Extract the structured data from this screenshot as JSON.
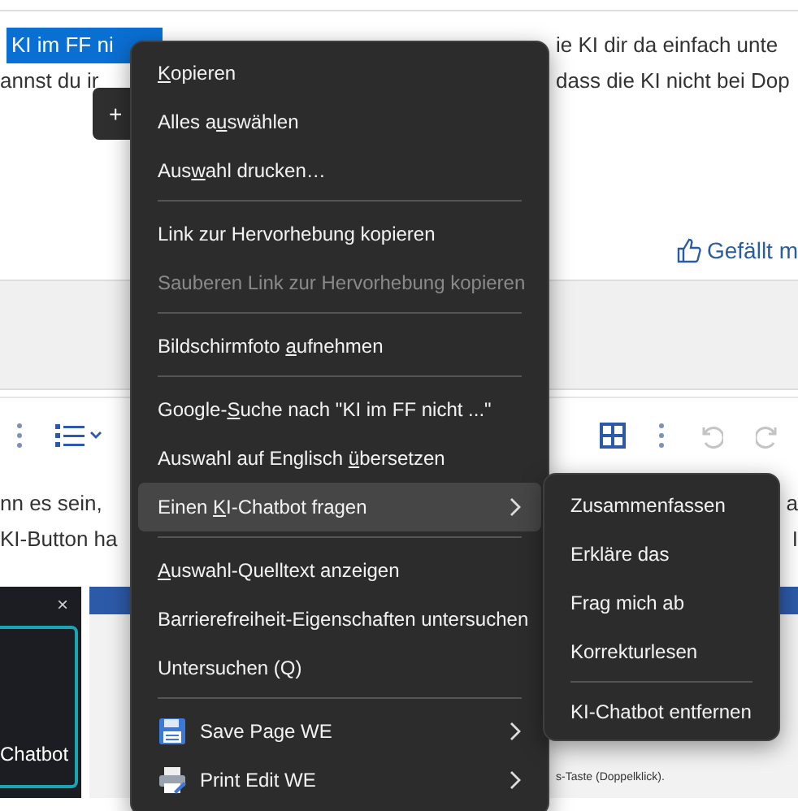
{
  "post": {
    "line_1": {
      "selection": "KI im FF ni",
      "right": "ie KI dir da einfach unte"
    },
    "line_2": {
      "left": "annst du ir",
      "right": "dass die KI nicht bei Dop"
    },
    "tooltip": "+",
    "like_link": "Gefällt m"
  },
  "reply_text": [
    {
      "left": "nn es sein,",
      "right": "a"
    },
    {
      "left": "KI-Button ha",
      "right": "I"
    }
  ],
  "side_panel": {
    "close": "×",
    "label": "Chatbot"
  },
  "embedded_page": {
    "caption": "s-Taste (Doppelklick)."
  },
  "context_menu": {
    "items": [
      {
        "kind": "item",
        "label_parts": [
          {
            "text": "K",
            "accesskey": true
          },
          {
            "text": "opieren",
            "accesskey": false
          }
        ],
        "disabled": false,
        "selected": false
      },
      {
        "kind": "item",
        "label_parts": [
          {
            "text": "Alles a",
            "accesskey": false
          },
          {
            "text": "u",
            "accesskey": true
          },
          {
            "text": "swählen",
            "accesskey": false
          }
        ],
        "disabled": false,
        "selected": false
      },
      {
        "kind": "item",
        "label_parts": [
          {
            "text": "Aus",
            "accesskey": false
          },
          {
            "text": "w",
            "accesskey": true
          },
          {
            "text": "ahl drucken…",
            "accesskey": false
          }
        ],
        "disabled": false,
        "selected": false
      },
      {
        "kind": "separator"
      },
      {
        "kind": "item",
        "label": "Link zur Hervorhebung kopieren",
        "disabled": false,
        "selected": false
      },
      {
        "kind": "item",
        "label": "Sauberen Link zur Hervorhebung kopieren",
        "disabled": true,
        "selected": false
      },
      {
        "kind": "separator"
      },
      {
        "kind": "item",
        "label_parts": [
          {
            "text": "Bildschirmfoto ",
            "accesskey": false
          },
          {
            "text": "a",
            "accesskey": true
          },
          {
            "text": "ufnehmen",
            "accesskey": false
          }
        ],
        "disabled": false,
        "selected": false
      },
      {
        "kind": "separator"
      },
      {
        "kind": "item",
        "label_parts": [
          {
            "text": "Google-",
            "accesskey": false
          },
          {
            "text": "S",
            "accesskey": true
          },
          {
            "text": "uche nach \"KI im FF nicht ...\"",
            "accesskey": false
          }
        ],
        "disabled": false,
        "selected": false
      },
      {
        "kind": "item",
        "label_parts": [
          {
            "text": "Auswahl auf Englisch ",
            "accesskey": false
          },
          {
            "text": "ü",
            "accesskey": true
          },
          {
            "text": "bersetzen",
            "accesskey": false
          }
        ],
        "disabled": false,
        "selected": false
      },
      {
        "kind": "submenu",
        "label_parts": [
          {
            "text": "Einen ",
            "accesskey": false
          },
          {
            "text": "K",
            "accesskey": true
          },
          {
            "text": "I-Chatbot fragen",
            "accesskey": false
          }
        ],
        "disabled": false,
        "selected": true
      },
      {
        "kind": "separator"
      },
      {
        "kind": "item",
        "label_parts": [
          {
            "text": "A",
            "accesskey": true
          },
          {
            "text": "uswahl-Quelltext anzeigen",
            "accesskey": false
          }
        ],
        "disabled": false,
        "selected": false
      },
      {
        "kind": "item",
        "label": "Barrierefreiheit-Eigenschaften untersuchen",
        "disabled": false,
        "selected": false
      },
      {
        "kind": "item",
        "label": "Untersuchen (Q)",
        "disabled": false,
        "selected": false
      },
      {
        "kind": "separator"
      },
      {
        "kind": "save_extension",
        "label": "Save Page WE",
        "disabled": false,
        "selected": false
      },
      {
        "kind": "print_extension",
        "label": "Print Edit WE",
        "disabled": false,
        "selected": false
      }
    ]
  },
  "submenu": {
    "items": [
      {
        "kind": "item",
        "label": "Zusammenfassen",
        "selected": false
      },
      {
        "kind": "item",
        "label": "Erkläre das",
        "selected": false
      },
      {
        "kind": "item",
        "label": "Frag mich ab",
        "selected": false
      },
      {
        "kind": "item",
        "label": "Korrekturlesen",
        "selected": false
      },
      {
        "kind": "separator"
      },
      {
        "kind": "item",
        "label": "KI-Chatbot entfernen",
        "selected": false
      }
    ]
  }
}
